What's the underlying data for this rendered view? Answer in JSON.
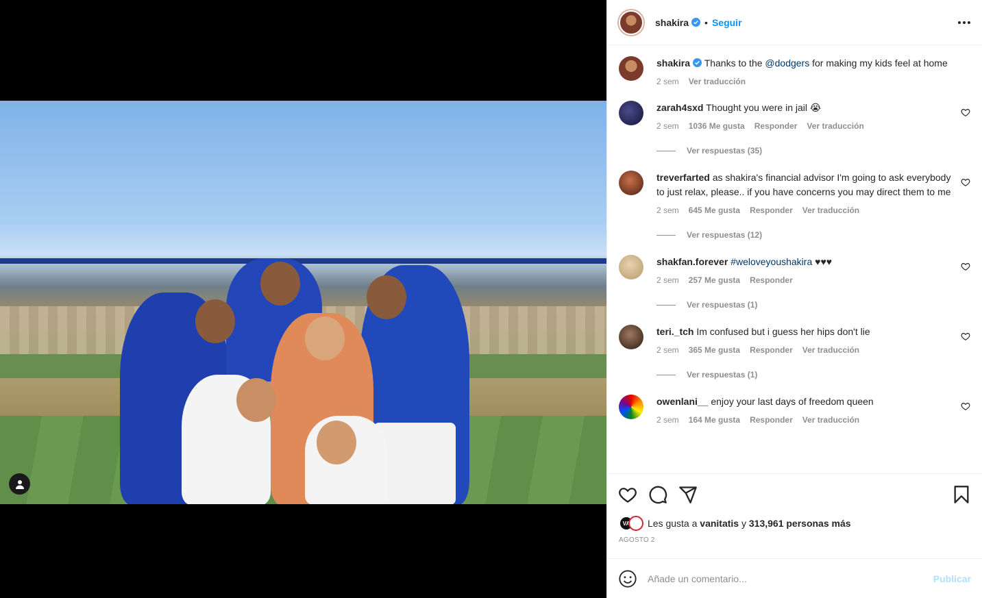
{
  "post": {
    "username": "shakira",
    "follow_label": "Seguir",
    "dot": "•",
    "caption_text_before": "Thanks to the ",
    "caption_mention": "@dodgers",
    "caption_text_after": " for making my kids feel at home",
    "caption_time": "2 sem",
    "caption_translate": "Ver traducción"
  },
  "comments": [
    {
      "user": "zarah4sxd",
      "text": " Thought you were in jail 😭",
      "time": "2 sem",
      "likes": "1036 Me gusta",
      "reply": "Responder",
      "translate": "Ver traducción",
      "replies": "Ver respuestas (35)"
    },
    {
      "user": "treverfarted",
      "text": " as shakira's financial advisor I'm going to ask everybody to just relax, please.. if you have concerns you may direct them to me",
      "time": "2 sem",
      "likes": "645 Me gusta",
      "reply": "Responder",
      "translate": "Ver traducción",
      "replies": "Ver respuestas (12)"
    },
    {
      "user": "shakfan.forever",
      "hashtag": " #weloveyoushakira",
      "text": " ♥♥♥",
      "time": "2 sem",
      "likes": "257 Me gusta",
      "reply": "Responder",
      "replies": "Ver respuestas (1)"
    },
    {
      "user": "teri._tch",
      "text": " Im confused but i guess her hips don't lie",
      "time": "2 sem",
      "likes": "365 Me gusta",
      "reply": "Responder",
      "translate": "Ver traducción",
      "replies": "Ver respuestas (1)"
    },
    {
      "user": "owenlani__",
      "text": " enjoy your last days of freedom queen",
      "time": "2 sem",
      "likes": "164 Me gusta",
      "reply": "Responder",
      "translate": "Ver traducción"
    }
  ],
  "likes": {
    "prefix": "Les gusta a ",
    "first_user": "vanitatis",
    "middle": " y ",
    "count": "313,961 personas más",
    "mini_avatar_text": "VA"
  },
  "date": "AGOSTO 2",
  "add_comment": {
    "placeholder": "Añade un comentario...",
    "publish_label": "Publicar"
  },
  "colors": {
    "accent": "#0095f6",
    "mention": "#00376b",
    "muted": "#8e8e8e"
  }
}
